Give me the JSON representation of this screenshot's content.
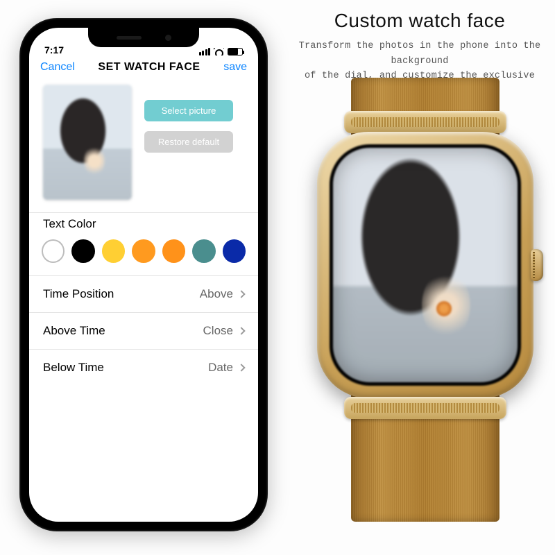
{
  "marketing": {
    "title": "Custom watch face",
    "desc_line1": "Transform the photos in the phone into the background",
    "desc_line2": "of the dial, and customize the exclusive dial"
  },
  "statusbar": {
    "time": "7:17"
  },
  "nav": {
    "cancel": "Cancel",
    "title": "SET WATCH FACE",
    "save": "save"
  },
  "buttons": {
    "select_picture": "Select picture",
    "restore_default": "Restore default"
  },
  "text_color": {
    "label": "Text Color",
    "options": [
      "white",
      "black",
      "yellow",
      "orange",
      "orange",
      "teal",
      "blue"
    ],
    "selected_index": 0
  },
  "rows": {
    "time_position": {
      "label": "Time Position",
      "value": "Above"
    },
    "above_time": {
      "label": "Above Time",
      "value": "Close"
    },
    "below_time": {
      "label": "Below Time",
      "value": "Date"
    }
  },
  "colors": {
    "accent_ios": "#0a84ff",
    "select_btn": "#72cdd1",
    "restore_btn": "#d2d2d2"
  }
}
